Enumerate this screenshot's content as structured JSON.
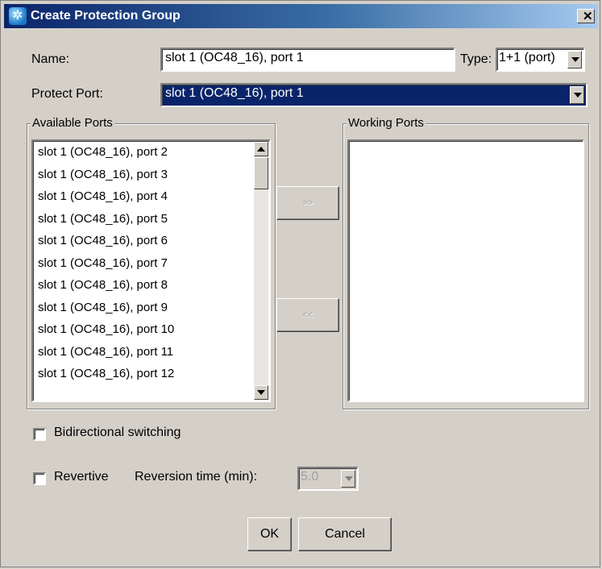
{
  "window": {
    "title": "Create Protection Group",
    "close_glyph": "✕",
    "icon": "app-icon"
  },
  "form": {
    "name_label": "Name:",
    "name_value": "slot  1 (OC48_16), port 1",
    "type_label": "Type:",
    "type_value": "1+1 (port)",
    "protect_label": "Protect Port:",
    "protect_value": "slot  1 (OC48_16), port 1"
  },
  "available_ports": {
    "title": "Available Ports",
    "items": [
      "slot  1 (OC48_16), port 2",
      "slot  1 (OC48_16), port 3",
      "slot  1 (OC48_16), port 4",
      "slot  1 (OC48_16), port 5",
      "slot  1 (OC48_16), port 6",
      "slot  1 (OC48_16), port 7",
      "slot  1 (OC48_16), port 8",
      "slot  1 (OC48_16), port 9",
      "slot  1 (OC48_16), port 10",
      "slot  1 (OC48_16), port 11",
      "slot  1 (OC48_16), port 12"
    ]
  },
  "working_ports": {
    "title": "Working Ports",
    "items": []
  },
  "transfer": {
    "add_label": ">>",
    "remove_label": "<<"
  },
  "options": {
    "bidirectional_label": "Bidirectional switching",
    "revertive_label": "Revertive",
    "reversion_label": "Reversion time (min):",
    "reversion_value": "5.0"
  },
  "actions": {
    "ok_label": "OK",
    "cancel_label": "Cancel"
  }
}
